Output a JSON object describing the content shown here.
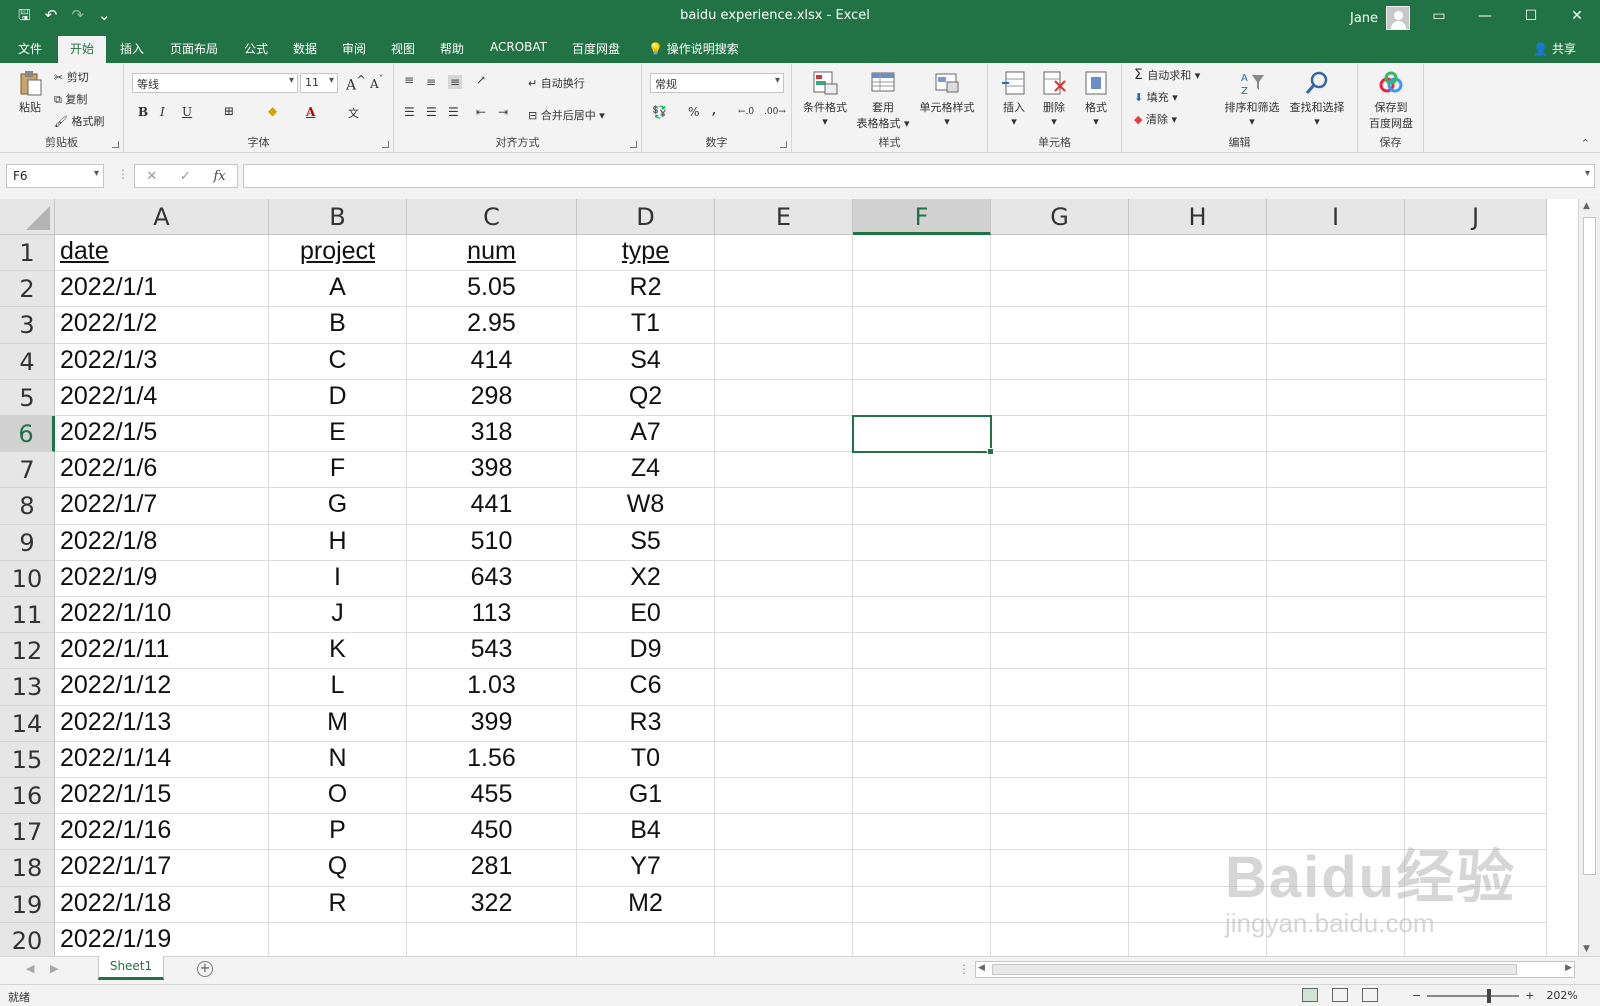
{
  "window": {
    "title": "baidu experience.xlsx  -  Excel",
    "user": "Jane",
    "qat": {
      "save": "🖫",
      "undo": "↶",
      "redo": "↷",
      "customize": "⌄"
    }
  },
  "tabs": [
    "文件",
    "开始",
    "插入",
    "页面布局",
    "公式",
    "数据",
    "审阅",
    "视图",
    "帮助",
    "ACROBAT",
    "百度网盘",
    "操作说明搜索"
  ],
  "share_label": "共享",
  "ribbon": {
    "clipboard": {
      "paste": "粘贴",
      "cut": "剪切",
      "copy": "复制",
      "format_painter": "格式刷",
      "label": "剪贴板"
    },
    "font": {
      "name": "等线",
      "size": "11",
      "bold": "B",
      "italic": "I",
      "underline": "U",
      "grow": "A",
      "shrink": "A",
      "label": "字体"
    },
    "alignment": {
      "wrap": "自动换行",
      "merge": "合并后居中",
      "label": "对齐方式"
    },
    "number": {
      "format": "常规",
      "percent": "%",
      "comma": ",",
      "label": "数字"
    },
    "styles": {
      "conditional": "条件格式",
      "table_line1": "套用",
      "table_line2": "表格格式",
      "cell_styles": "单元格样式",
      "label": "样式"
    },
    "cells": {
      "insert": "插入",
      "delete": "删除",
      "format": "格式",
      "label": "单元格"
    },
    "editing": {
      "autosum": "自动求和",
      "fill": "填充",
      "clear": "清除",
      "sort": "排序和筛选",
      "find": "查找和选择",
      "label": "编辑"
    },
    "save": {
      "save_line1": "保存到",
      "save_line2": "百度网盘",
      "label": "保存"
    }
  },
  "formula_bar": {
    "name_box": "F6",
    "cancel": "✕",
    "enter": "✓",
    "fx": "fx",
    "value": ""
  },
  "columns": [
    "A",
    "B",
    "C",
    "D",
    "E",
    "F",
    "G",
    "H",
    "I",
    "J"
  ],
  "selected_cell": {
    "col": "F",
    "row": 6
  },
  "headers": [
    "date",
    "project",
    "num",
    "type"
  ],
  "rows": [
    [
      "2022/1/1",
      "A",
      "5.05",
      "R2"
    ],
    [
      "2022/1/2",
      "B",
      "2.95",
      "T1"
    ],
    [
      "2022/1/3",
      "C",
      "414",
      "S4"
    ],
    [
      "2022/1/4",
      "D",
      "298",
      "Q2"
    ],
    [
      "2022/1/5",
      "E",
      "318",
      "A7"
    ],
    [
      "2022/1/6",
      "F",
      "398",
      "Z4"
    ],
    [
      "2022/1/7",
      "G",
      "441",
      "W8"
    ],
    [
      "2022/1/8",
      "H",
      "510",
      "S5"
    ],
    [
      "2022/1/9",
      "I",
      "643",
      "X2"
    ],
    [
      "2022/1/10",
      "J",
      "113",
      "E0"
    ],
    [
      "2022/1/11",
      "K",
      "543",
      "D9"
    ],
    [
      "2022/1/12",
      "L",
      "1.03",
      "C6"
    ],
    [
      "2022/1/13",
      "M",
      "399",
      "R3"
    ],
    [
      "2022/1/14",
      "N",
      "1.56",
      "T0"
    ],
    [
      "2022/1/15",
      "O",
      "455",
      "G1"
    ],
    [
      "2022/1/16",
      "P",
      "450",
      "B4"
    ],
    [
      "2022/1/17",
      "Q",
      "281",
      "Y7"
    ],
    [
      "2022/1/18",
      "R",
      "322",
      "M2"
    ],
    [
      "2022/1/19",
      "",
      "",
      ""
    ]
  ],
  "sheets": [
    "Sheet1"
  ],
  "add_sheet": "+",
  "status": {
    "ready": "就绪",
    "zoom_minus": "−",
    "zoom_plus": "+",
    "zoom": "202%"
  },
  "watermark": {
    "brand": "Baidu经验",
    "url": "jingyan.baidu.com"
  },
  "colors": {
    "accent": "#217346",
    "ribbon_bg": "#f3f3f3",
    "header_bg": "#e6e6e6"
  }
}
